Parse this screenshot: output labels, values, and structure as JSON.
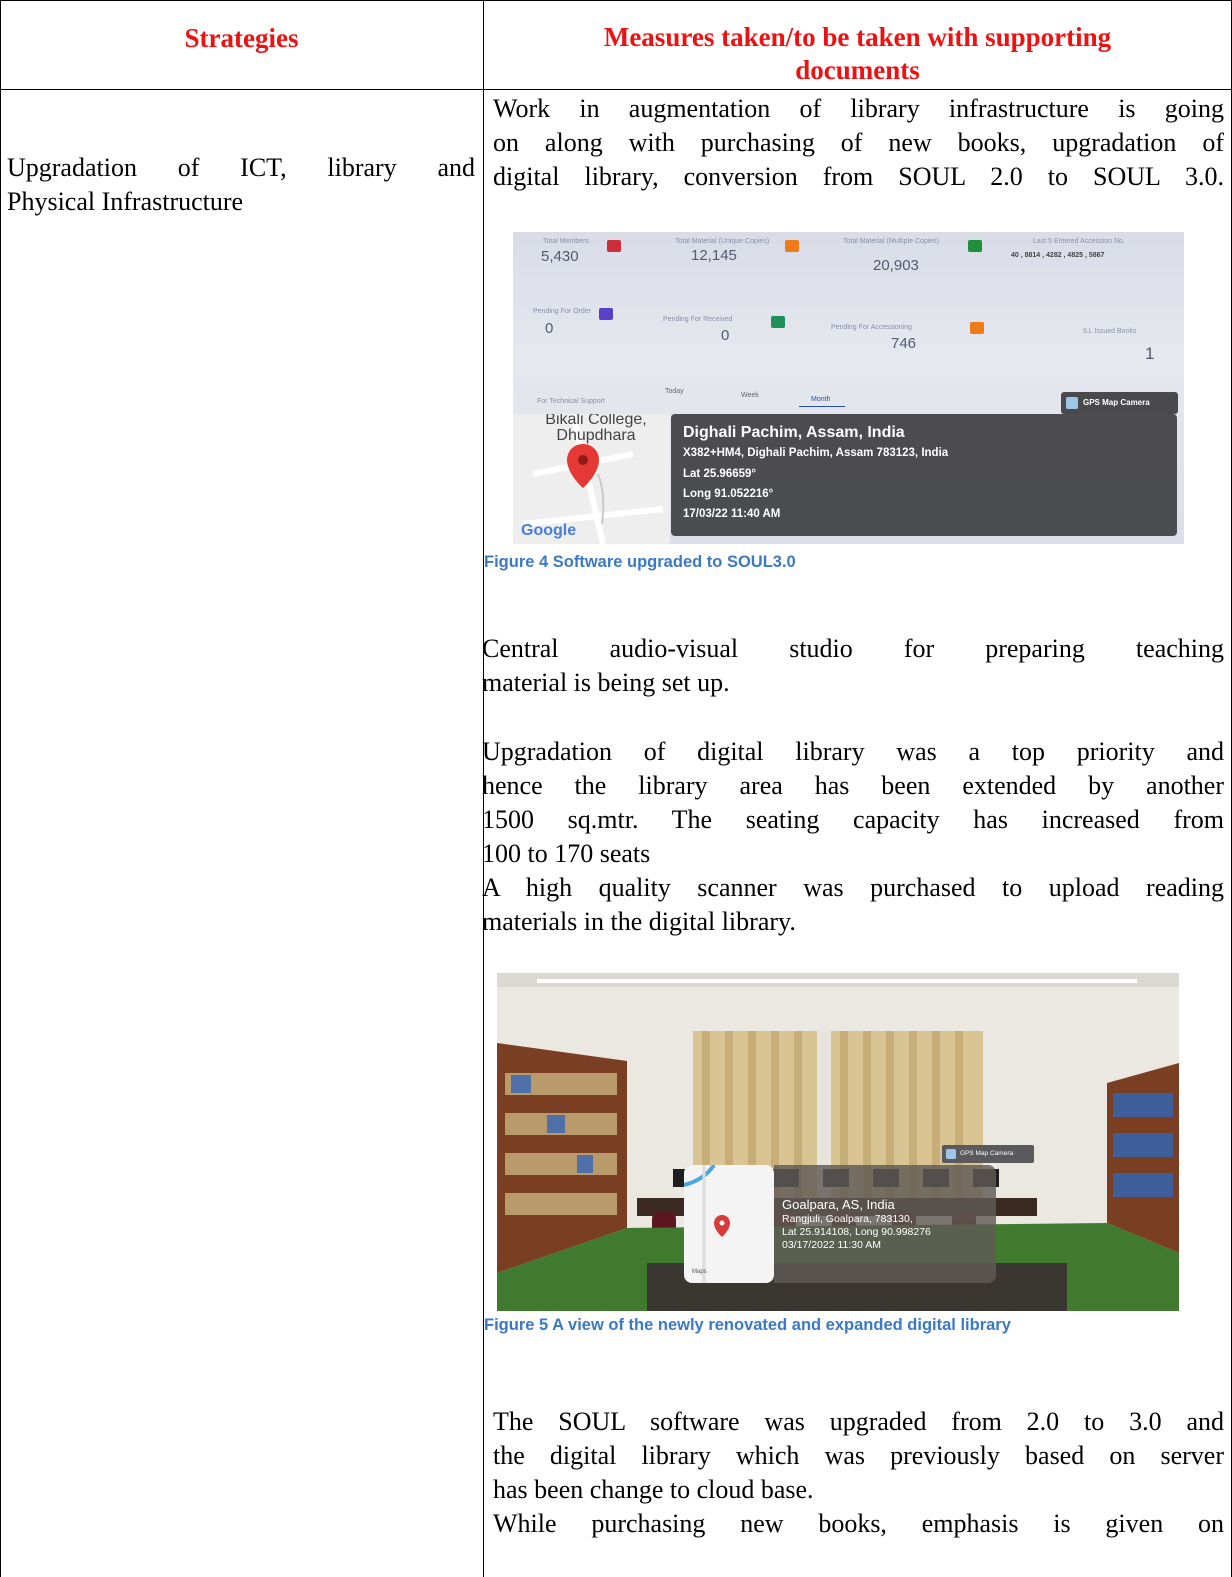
{
  "table": {
    "header_left": "Strategies",
    "header_right_line1": "Measures taken/to be taken with supporting",
    "header_right_line2": "documents",
    "strategy_line1": "Upgradation of ICT, library and",
    "strategy_line2": "Physical Infrastructure"
  },
  "measures": {
    "p1": [
      "Work in augmentation of library infrastructure is going",
      "on along with purchasing of new books, upgradation of",
      "digital library, conversion from SOUL 2.0 to SOUL 3.0."
    ],
    "p2": [
      "Central audio-visual studio for preparing teaching",
      "material is being set up."
    ],
    "p3": [
      "Upgradation of digital library was a top priority and",
      "hence the library area has been extended by another",
      "1500 sq.mtr. The seating capacity has increased from",
      "100 to 170 seats",
      "A high quality scanner was purchased to upload reading",
      "materials in the digital library."
    ],
    "p4": [
      "The SOUL software was upgraded from 2.0 to 3.0 and",
      "the digital library which was previously based on server",
      "has been change to cloud base.",
      "While purchasing new books, emphasis is given on"
    ]
  },
  "figure4": {
    "caption": "Figure 4 Software upgraded to SOUL3.0",
    "dashboard": {
      "total_members_label": "Total Members",
      "total_members": "5,430",
      "unique_label": "Total Material (Unique Copies)",
      "unique": "12,145",
      "multiple_label": "Total Material (Multiple Copies)",
      "multiple": "20,903",
      "accession_label": "Last 5 Entered Accession No.",
      "accession": "40 , 8814 , 4282 , 4825 , 5867",
      "pending_order_label": "Pending For Order",
      "pending_order": "0",
      "pending_received_label": "Pending For Received",
      "pending_received": "0",
      "pending_accession_label": "Pending For Accessioning",
      "pending_accession": "746",
      "ill_label": "ILL Issued Books",
      "ill": "1",
      "tab_today": "Today",
      "tab_week": "Week",
      "tab_month": "Month",
      "support_label": "For Technical Support"
    },
    "gps_badge": "GPS Map Camera",
    "map_place": "Bikali College, Dhupdhara",
    "map_brand": "Google",
    "geo": {
      "place": "Dighali Pachim, Assam, India",
      "address": "X382+HM4, Dighali Pachim, Assam 783123, India",
      "lat": "Lat 25.96659°",
      "long": "Long 91.052216°",
      "time": "17/03/22 11:40 AM"
    }
  },
  "figure5": {
    "caption": "Figure 5 A view of the newly renovated and expanded digital library",
    "gps_badge": "GPS Map Camera",
    "map_brand": "Maps",
    "geo": {
      "place": "Goalpara, AS, India",
      "address": "Rangjuli, Goalpara, 783130,",
      "coords": "Lat 25.914108, Long 90.998276",
      "time": "03/17/2022 11:30 AM"
    }
  },
  "colors": {
    "header_red": "#ee1111",
    "caption_blue": "#3a79c7"
  }
}
